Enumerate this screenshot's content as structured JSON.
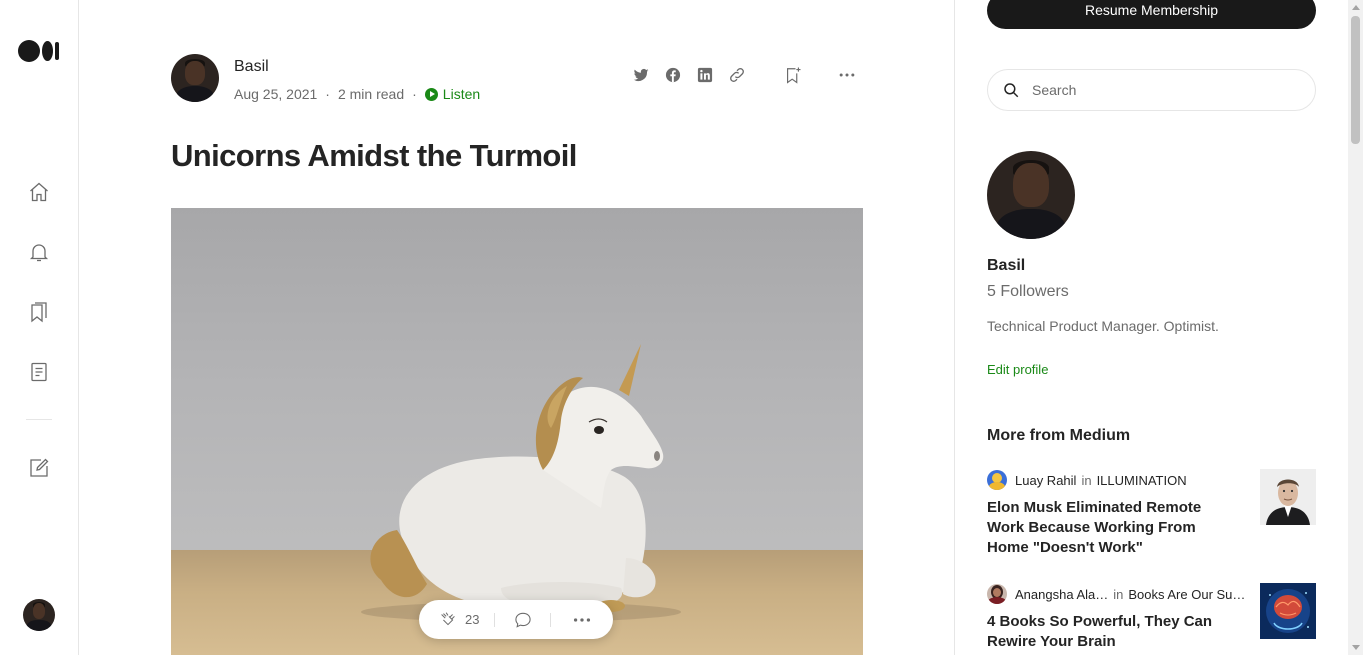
{
  "article": {
    "author": "Basil",
    "date": "Aug 25, 2021",
    "read_time": "2 min read",
    "listen_label": "Listen",
    "title": "Unicorns Amidst the Turmoil",
    "clap_count": "23"
  },
  "nav_icons": [
    "medium-logo",
    "home-icon",
    "bell-icon",
    "bookmarks-icon",
    "stories-icon",
    "write-icon"
  ],
  "share_icons": [
    "twitter-icon",
    "facebook-icon",
    "linkedin-icon",
    "link-icon",
    "bookmark-add-icon",
    "more-icon"
  ],
  "sidebar": {
    "resume_button": "Resume Membership",
    "search_placeholder": "Search",
    "profile": {
      "name": "Basil",
      "followers": "5 Followers",
      "bio": "Technical Product Manager. Optimist.",
      "edit_label": "Edit profile"
    },
    "more_from": "More from Medium",
    "recommendations": [
      {
        "author": "Luay Rahil",
        "in_label": "in",
        "publication": "ILLUMINATION",
        "headline": "Elon Musk Eliminated Remote Work Because Working From Home \"Doesn't Work\""
      },
      {
        "author": "Anangsha Ala…",
        "in_label": "in",
        "publication": "Books Are Our Su…",
        "headline": "4 Books So Powerful, They Can Rewire Your Brain"
      }
    ]
  },
  "colors": {
    "accent_green": "#1a8917",
    "text_primary": "#242424",
    "text_secondary": "#6b6b6b",
    "button_dark": "#191919"
  }
}
